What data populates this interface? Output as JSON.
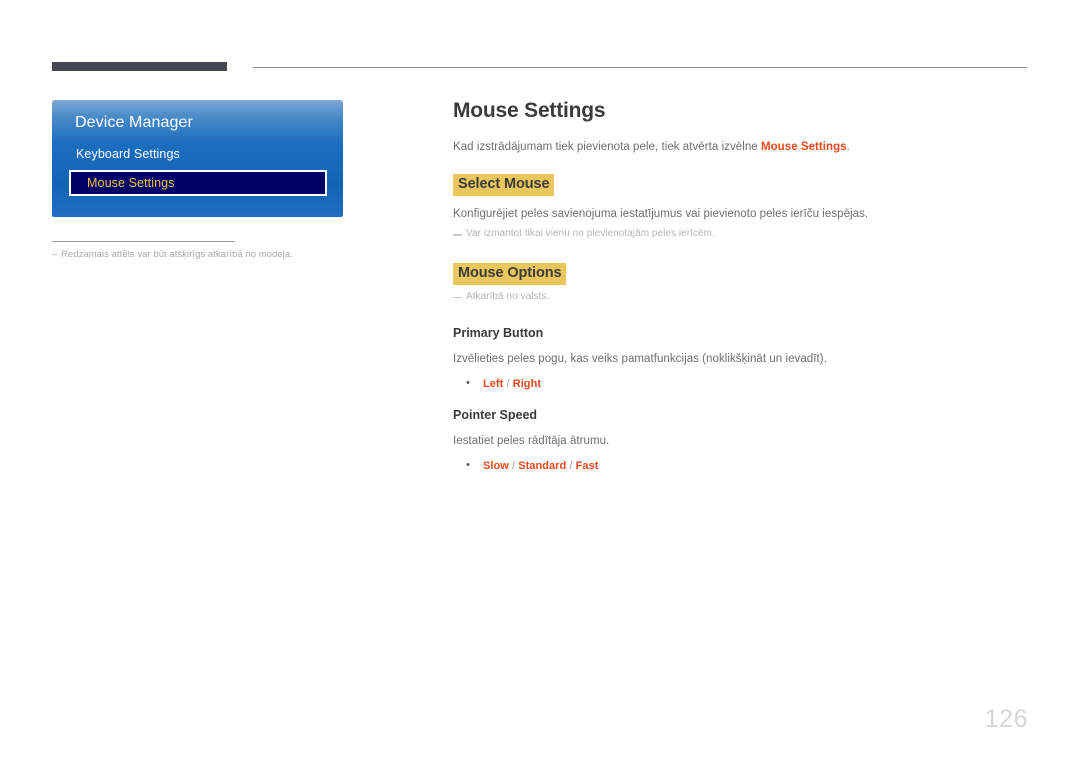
{
  "document": {
    "page_number": "126"
  },
  "osd": {
    "title": "Device Manager",
    "items": [
      {
        "label": "Keyboard Settings",
        "selected": false
      },
      {
        "label": "Mouse Settings",
        "selected": true
      }
    ],
    "colors": {
      "panel_top": "#7fa8d6",
      "panel_bottom": "#1464b5",
      "selection_fill": "#000066",
      "selection_text": "#f2c13a",
      "selection_border": "#ffffff"
    }
  },
  "footnote": {
    "dash": "–",
    "text": "Redzamais attēls var būt atšķirīgs atkarībā no modeļa."
  },
  "content": {
    "title": "Mouse Settings",
    "intro_before": "Kad izstrādājumam tiek pievienota pele, tiek atvērta izvēlne ",
    "intro_accent": "Mouse Settings",
    "intro_after": ".",
    "sections": [
      {
        "heading": "Select Mouse",
        "body": "Konfigurējiet peles savienojuma iestatījumus vai pievienoto peles ierīču iespējas.",
        "note": "Var izmantot tikai vienu no pievienotajām peles ierīcēm."
      },
      {
        "heading": "Mouse Options",
        "note": "Atkarībā no valsts."
      }
    ],
    "options": [
      {
        "name": "Primary Button",
        "description": "Izvēlieties peles pogu, kas veiks pamatfunkcijas (noklikšķināt un ievadīt).",
        "values": [
          "Left",
          "Right"
        ],
        "separator": " / "
      },
      {
        "name": "Pointer Speed",
        "description": "Iestatiet peles rādītāja ātrumu.",
        "values": [
          "Slow",
          "Standard",
          "Fast"
        ],
        "separator": " / "
      }
    ],
    "colors": {
      "accent": "#e8491d",
      "highlight": "#e9c75d",
      "heading_text": "#3b3b3b",
      "body_text": "#6e6e72",
      "note_text": "#b6b6bb"
    }
  }
}
